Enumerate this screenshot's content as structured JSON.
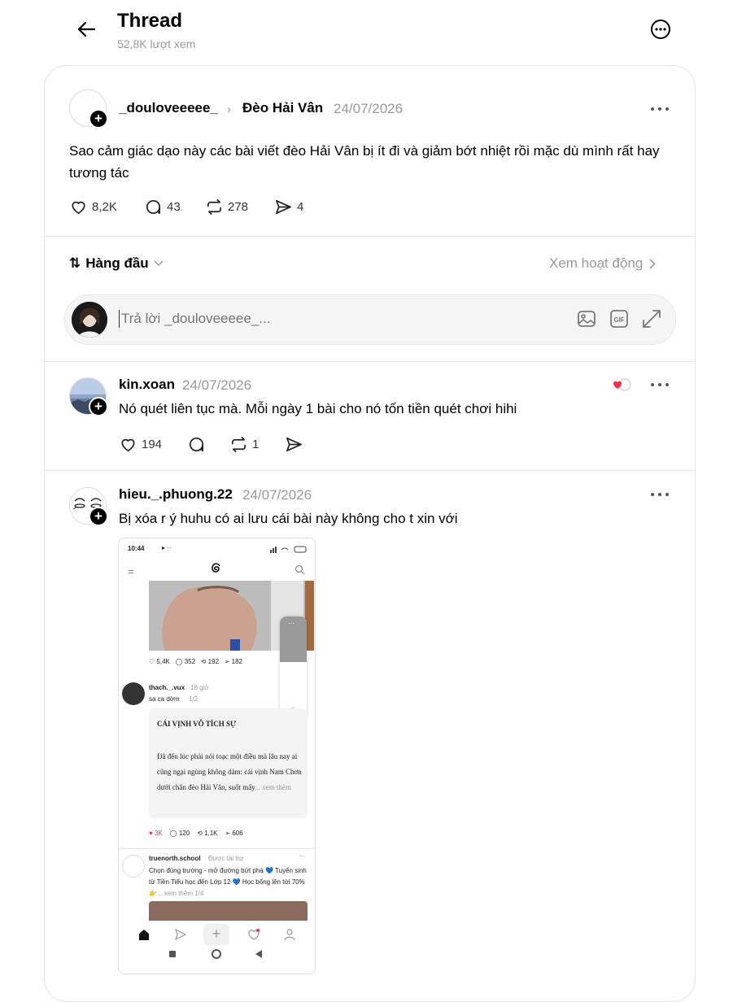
{
  "header": {
    "title": "Thread",
    "views": "52,8K lượt xem"
  },
  "post": {
    "username": "_douloveeeee_",
    "topic": "Đèo Hải Vân",
    "date": "24/07/2026",
    "text": "Sao cảm giác dạo này các bài viết đèo Hải Vân bị ít đi và giảm bớt nhiệt rồi mặc dù mình rất hay tương tác",
    "likes": "8,2K",
    "comments": "43",
    "reposts": "278",
    "shares": "4"
  },
  "sort": {
    "label": "Hàng đầu",
    "activity": "Xem hoạt động"
  },
  "reply": {
    "placeholder": "Trả lời _douloveeeee_..."
  },
  "replies": [
    {
      "username": "kin.xoan",
      "date": "24/07/2026",
      "text": "Nó quét liên tục mà. Mỗi ngày 1 bài cho nó tốn tiền quét chơi hihi",
      "likes": "194",
      "reposts": "1"
    },
    {
      "username": "hieu._.phuong.22",
      "date": "24/07/2026",
      "text": "Bị xóa r ý huhu có ai lưu cái bài này không cho t xin với"
    }
  ],
  "screenshot": {
    "time": "10:44",
    "top_stats": {
      "likes": "5,4K",
      "comments": "352",
      "reposts": "192",
      "shares": "182"
    },
    "comment_user": "thach._.vux",
    "comment_time": "18 giờ",
    "comment_text": "sa ca dờm",
    "comment_page": "1/2",
    "quote_title": "CÁI VỊNH VÔ TÍCH SỰ",
    "quote_body": "Đã đến lúc phải nói toạc một điều mà lâu nay ai cũng ngại ngùng không dám: cái vịnh Nam Chơn dưới chân đèo Hải Vân, suốt mấy",
    "quote_more": "... xem thêm",
    "stats": {
      "likes": "3K",
      "comments": "120",
      "reposts": "1,1K",
      "shares": "606"
    },
    "ad_user": "truenorth.school",
    "ad_tag": "Được tài trợ",
    "ad_text": "Chọn đúng trường - mở đường bứt phá 💙 Tuyển sinh từ Tiền Tiểu học đến Lớp 12 💙 Học bổng lên tới 70% 👉",
    "ad_more": "... xem thêm",
    "ad_page": "1/4"
  }
}
